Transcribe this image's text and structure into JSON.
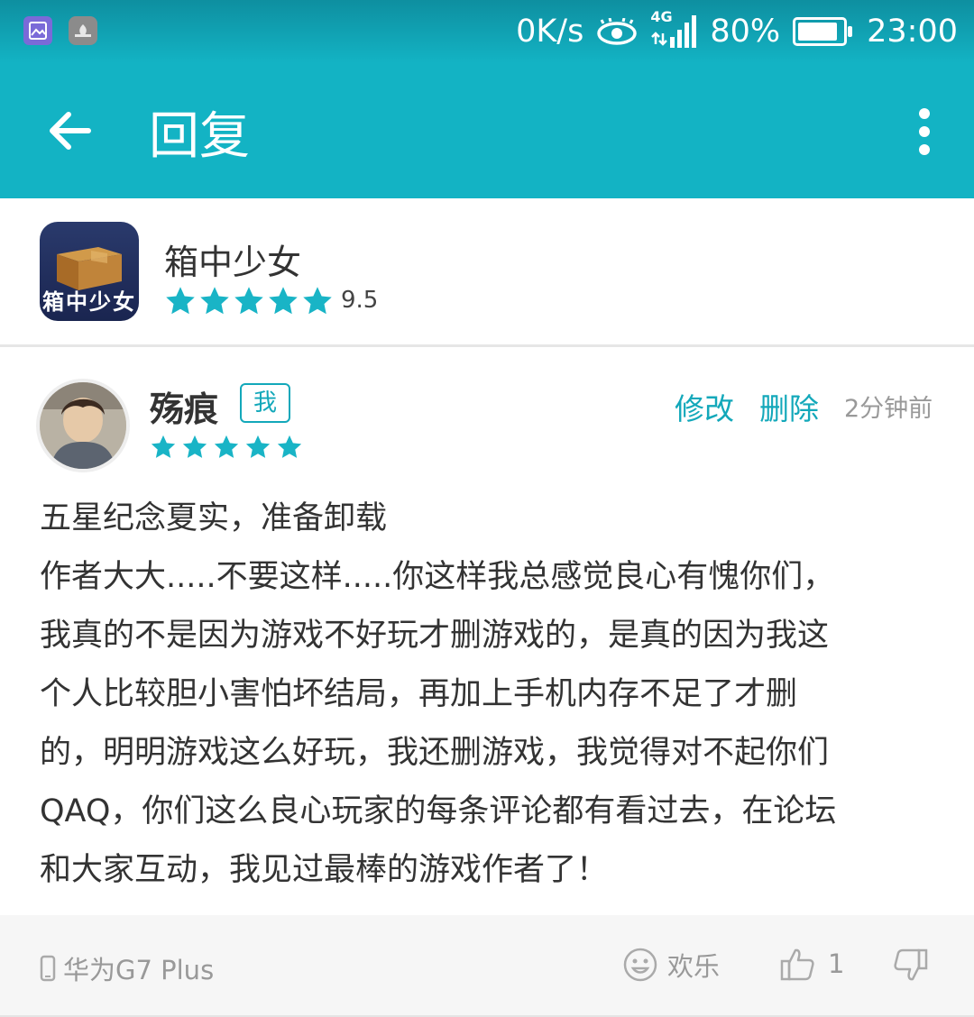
{
  "status_bar": {
    "speed": "0K/s",
    "network": "4G",
    "battery_text": "80%",
    "battery_level": 0.8,
    "time": "23:00"
  },
  "app_bar": {
    "title": "回复"
  },
  "game": {
    "name": "箱中少女",
    "icon_caption": "箱中少女",
    "stars": 5,
    "score": "9.5"
  },
  "review": {
    "username": "殇痕",
    "me_badge": "我",
    "stars": 5,
    "edit_label": "修改",
    "delete_label": "删除",
    "time": "2分钟前",
    "lines": [
      "五星纪念夏实，准备卸载",
      "作者大大.....不要这样.....你这样我总感觉良心有愧你们，",
      "我真的不是因为游戏不好玩才删游戏的，是真的因为我这",
      "个人比较胆小害怕坏结局，再加上手机内存不足了才删",
      "的，明明游戏这么好玩，我还删游戏，我觉得对不起你们",
      "QAQ，你们这么良心玩家的每条评论都有看过去，在论坛",
      "和大家互动，我见过最棒的游戏作者了！"
    ]
  },
  "footer": {
    "device": "华为G7 Plus",
    "emotion_label": "欢乐",
    "like_count": "1"
  },
  "colors": {
    "accent": "#13b3c4",
    "star": "#19b4c6"
  }
}
